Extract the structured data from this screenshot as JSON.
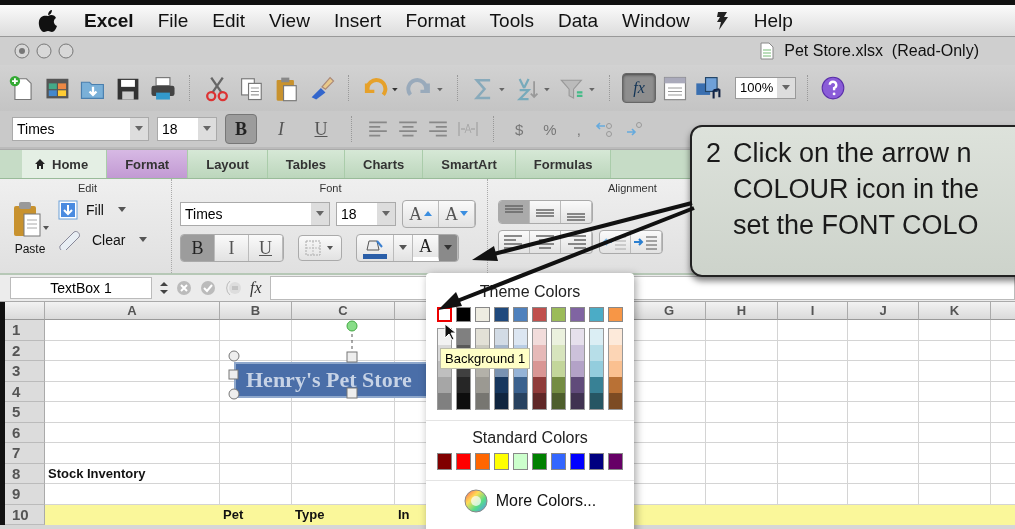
{
  "menu_bar": {
    "items": [
      {
        "kind": "app",
        "label": "Excel"
      },
      {
        "kind": "menu",
        "label": "File"
      },
      {
        "kind": "menu",
        "label": "Edit"
      },
      {
        "kind": "menu",
        "label": "View"
      },
      {
        "kind": "menu",
        "label": "Insert"
      },
      {
        "kind": "menu",
        "label": "Format"
      },
      {
        "kind": "menu",
        "label": "Tools"
      },
      {
        "kind": "menu",
        "label": "Data"
      },
      {
        "kind": "menu",
        "label": "Window"
      },
      {
        "kind": "script"
      },
      {
        "kind": "menu",
        "label": "Help"
      }
    ]
  },
  "window": {
    "title": "Pet Store.xlsx  (Read-Only)"
  },
  "standard_toolbar": {
    "formula_builder": {
      "label": "fx",
      "pressed": true
    },
    "zoom": "100%"
  },
  "formatting_toolbar": {
    "font": "Times",
    "size": "18",
    "style_buttons": [
      {
        "label": "B",
        "pressed": true
      },
      {
        "label": "I",
        "pressed": false
      },
      {
        "label": "U",
        "pressed": false
      }
    ],
    "number_buttons": [
      "$",
      "%",
      ","
    ]
  },
  "ribbon": {
    "tabs": [
      {
        "label": "Home",
        "selected": false
      },
      {
        "label": "Format",
        "selected": true
      },
      {
        "label": "Layout",
        "selected": false
      },
      {
        "label": "Tables",
        "selected": false
      },
      {
        "label": "Charts",
        "selected": false
      },
      {
        "label": "SmartArt",
        "selected": false
      },
      {
        "label": "Formulas",
        "selected": false
      }
    ],
    "groups": [
      "Edit",
      "Font",
      "Alignment"
    ],
    "paste": "Paste",
    "fill": "Fill",
    "clear": "Clear",
    "font": "Times",
    "size": "18",
    "grow": "A",
    "shrink": "A",
    "style_buttons": [
      {
        "label": "B",
        "pressed": true
      },
      {
        "label": "I",
        "pressed": false
      },
      {
        "label": "U",
        "pressed": false
      }
    ],
    "font_color": {
      "label": "A",
      "pressed": true
    }
  },
  "formula_bar": {
    "name_box": "TextBox 1",
    "fx": "fx"
  },
  "sheet": {
    "columns_left": [
      "A",
      "B",
      "C"
    ],
    "columns_right": [
      "G",
      "H",
      "I",
      "J",
      "K"
    ],
    "rows": [
      {
        "header": "1",
        "highlighted": false
      },
      {
        "header": "2",
        "highlighted": false
      },
      {
        "header": "3",
        "highlighted": false
      },
      {
        "header": "4",
        "highlighted": false
      },
      {
        "header": "5",
        "highlighted": false
      },
      {
        "header": "6",
        "highlighted": false
      },
      {
        "header": "7",
        "highlighted": false
      },
      {
        "header": "8",
        "highlighted": false,
        "a": "Stock Inventory"
      },
      {
        "header": "9",
        "highlighted": false
      },
      {
        "header": "10",
        "highlighted": true,
        "b": "Pet",
        "c": "Type",
        "d": "In"
      }
    ],
    "text_box": "Henry's Pet Store"
  },
  "color_menu": {
    "theme_heading": "Theme Colors",
    "theme_colors": [
      {
        "color": "#ffffff",
        "selected": true
      },
      {
        "color": "#000000",
        "selected": false
      },
      {
        "color": "#eeece1",
        "selected": false
      },
      {
        "color": "#1f497d",
        "selected": false
      },
      {
        "color": "#4f81bd",
        "selected": false
      },
      {
        "color": "#c0504d",
        "selected": false
      },
      {
        "color": "#9bbb59",
        "selected": false
      },
      {
        "color": "#8064a2",
        "selected": false
      },
      {
        "color": "#4bacc6",
        "selected": false
      },
      {
        "color": "#f79646",
        "selected": false
      }
    ],
    "tooltip": "Background 1",
    "standard_heading": "Standard Colors",
    "standard_colors": [
      {
        "color": "#800000",
        "selected": false
      },
      {
        "color": "#ff0000",
        "selected": false
      },
      {
        "color": "#ff6600",
        "selected": false
      },
      {
        "color": "#ffff00",
        "selected": false
      },
      {
        "color": "#ccffcc",
        "selected": false
      },
      {
        "color": "#008000",
        "selected": false
      },
      {
        "color": "#3366ff",
        "selected": false
      },
      {
        "color": "#0000ff",
        "selected": false
      },
      {
        "color": "#000080",
        "selected": false
      },
      {
        "color": "#660066",
        "selected": false
      }
    ],
    "more": "More Colors..."
  },
  "callout": {
    "number": "2",
    "lines": [
      "Click on the arrow n",
      "COLOUR icon in the",
      "set the FONT COLO"
    ]
  }
}
